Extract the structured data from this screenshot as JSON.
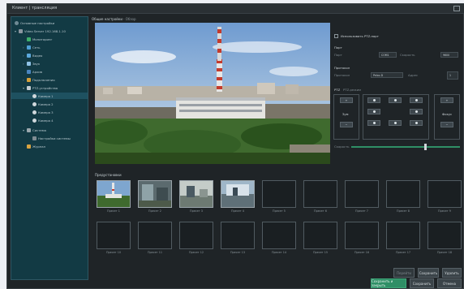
{
  "window": {
    "title": "Клиент | трансляция"
  },
  "breadcrumb": {
    "main": "Общие настройки",
    "sub": "Обзор"
  },
  "sidebar": {
    "items": [
      {
        "label": "Основные настройки",
        "icon": "settings-icon"
      },
      {
        "label": "Video Server 192.168.1.10",
        "icon": "server-icon"
      },
      {
        "label": "Мониторинг",
        "icon": "monitor-icon"
      },
      {
        "label": "Сеть",
        "icon": "network-icon"
      },
      {
        "label": "Видео",
        "icon": "video-icon"
      },
      {
        "label": "Звук",
        "icon": "audio-icon"
      },
      {
        "label": "Архив",
        "icon": "archive-icon"
      },
      {
        "label": "Подключения",
        "icon": "warning-icon"
      },
      {
        "label": "PTZ-устройства",
        "icon": "ptz-icon"
      },
      {
        "label": "Камера 1",
        "icon": "camera-icon"
      },
      {
        "label": "Камера 2",
        "icon": "camera-icon"
      },
      {
        "label": "Камера 3",
        "icon": "camera-icon"
      },
      {
        "label": "Камера 4",
        "icon": "camera-icon"
      },
      {
        "label": "Система",
        "icon": "system-icon"
      },
      {
        "label": "Настройки системы",
        "icon": "gear-icon"
      },
      {
        "label": "Журнал",
        "icon": "log-icon"
      }
    ]
  },
  "right_panel": {
    "use_ptz_checkbox": "Использовать PTZ-порт",
    "port_title": "Порт",
    "port_label": "Порт",
    "port_value": "COM1",
    "speed_label": "Скорость",
    "speed_value": "9600",
    "protocol_title": "Протокол",
    "protocol_label": "Протокол",
    "protocol_value": "Pelco-D",
    "address_label": "Адрес",
    "address_value": "1",
    "ptz_title": "PTZ",
    "ptz_mode": "PTZ-режим",
    "zoom_label": "Зум",
    "focus_label": "Фокус",
    "speed_slider_label": "Скорость"
  },
  "presets": {
    "title": "Предустановки",
    "row1": [
      "Пресет 1",
      "Пресет 2",
      "Пресет 3",
      "Пресет 4",
      "Пресет 5",
      "Пресет 6",
      "Пресет 7",
      "Пресет 8",
      "Пресет 9"
    ],
    "row2": [
      "Пресет 10",
      "Пресет 11",
      "Пресет 12",
      "Пресет 13",
      "Пресет 14",
      "Пресет 15",
      "Пресет 16",
      "Пресет 17",
      "Пресет 18"
    ]
  },
  "buttons": {
    "go": "Перейти",
    "save_preset": "Сохранить",
    "delete_preset": "Удалить",
    "save_close": "Сохранить и закрыть",
    "save": "Сохранить",
    "cancel": "Отмена"
  },
  "colors": {
    "accent": "#2f8f66",
    "sidebar_bg": "#123a44",
    "window_bg": "#1f2427"
  }
}
